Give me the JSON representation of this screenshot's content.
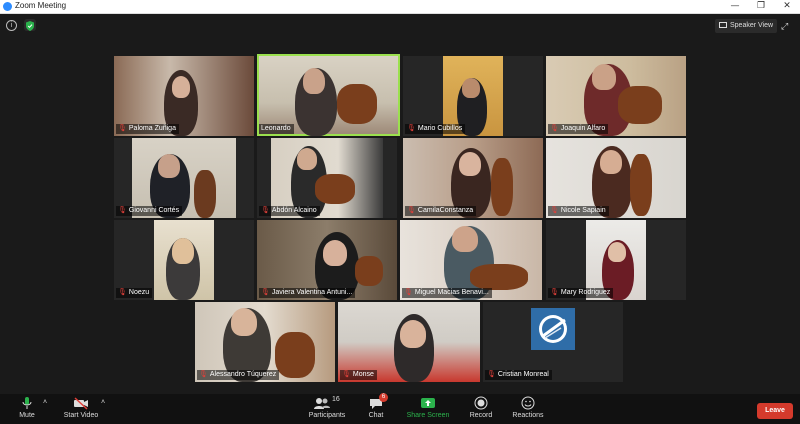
{
  "window": {
    "title": "Zoom Meeting",
    "minimize_glyph": "—",
    "maximize_glyph": "❐",
    "close_glyph": "✕"
  },
  "top": {
    "speaker_view_label": "Speaker View",
    "info_glyph": "i",
    "fullscreen_glyph": "⤢"
  },
  "participants": [
    {
      "name": "Paloma Zuñiga"
    },
    {
      "name": "Leonardo"
    },
    {
      "name": "Mario Cubillos"
    },
    {
      "name": "Joaquin Alfaro"
    },
    {
      "name": "Giovanni Cortés"
    },
    {
      "name": "Abdón Alcaino"
    },
    {
      "name": "CamilaConstanza"
    },
    {
      "name": "Nicole Sapiain"
    },
    {
      "name": "Noezu"
    },
    {
      "name": "Javiera Valentina Antuni..."
    },
    {
      "name": "Miguel Macias Benavi..."
    },
    {
      "name": "Mary Rodriguez"
    },
    {
      "name": "Alessandro Túquerez"
    },
    {
      "name": "Monse"
    },
    {
      "name": "Cristian Monreal"
    }
  ],
  "toolbar": {
    "mute": "Mute",
    "start_video": "Start Video",
    "participants": "Participants",
    "participants_count": "16",
    "chat": "Chat",
    "chat_badge": "6",
    "share_screen": "Share Screen",
    "record": "Record",
    "reactions": "Reactions",
    "leave": "Leave"
  },
  "colors": {
    "active_speaker": "#9be04e",
    "share_screen": "#2bb24c",
    "leave": "#d43a2c"
  }
}
